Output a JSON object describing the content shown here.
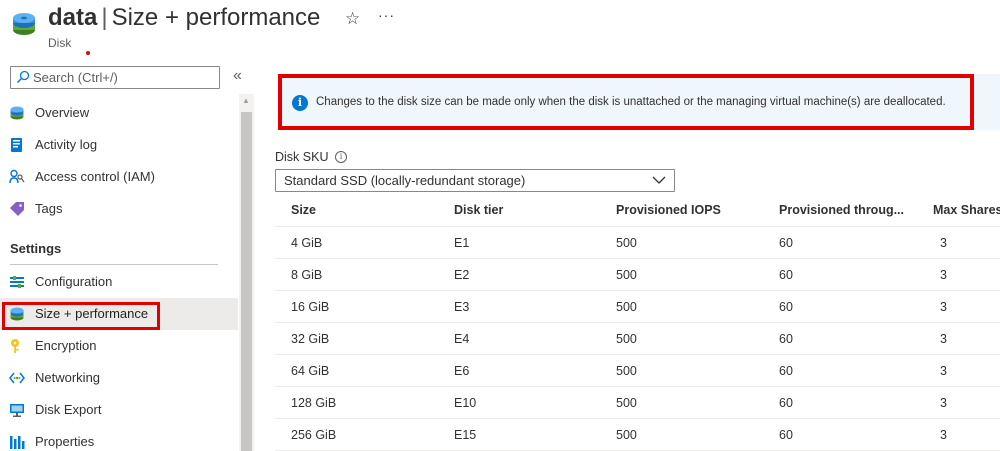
{
  "header": {
    "resource_name": "data",
    "separator": "|",
    "page_title": "Size + performance",
    "subtitle": "Disk",
    "favorite_icon": "star-icon",
    "more_icon": "more-icon"
  },
  "sidebar": {
    "search_placeholder": "Search (Ctrl+/)",
    "collapse_label": "«",
    "items_top": [
      {
        "label": "Overview",
        "icon": "disk-icon"
      },
      {
        "label": "Activity log",
        "icon": "activity-log-icon"
      },
      {
        "label": "Access control (IAM)",
        "icon": "access-control-icon"
      },
      {
        "label": "Tags",
        "icon": "tag-icon"
      }
    ],
    "section_title": "Settings",
    "items_settings": [
      {
        "label": "Configuration",
        "icon": "configuration-icon"
      },
      {
        "label": "Size + performance",
        "icon": "disk-icon",
        "active": true
      },
      {
        "label": "Encryption",
        "icon": "key-icon"
      },
      {
        "label": "Networking",
        "icon": "networking-icon"
      },
      {
        "label": "Disk Export",
        "icon": "export-icon"
      },
      {
        "label": "Properties",
        "icon": "properties-icon"
      }
    ]
  },
  "main": {
    "info_message": "Changes to the disk size can be made only when the disk is unattached or the managing virtual machine(s) are deallocated.",
    "sku_label": "Disk SKU",
    "sku_value": "Standard SSD (locally-redundant storage)",
    "table": {
      "columns": [
        "Size",
        "Disk tier",
        "Provisioned IOPS",
        "Provisioned throug...",
        "Max Shares"
      ],
      "rows": [
        [
          "4 GiB",
          "E1",
          "500",
          "60",
          "3"
        ],
        [
          "8 GiB",
          "E2",
          "500",
          "60",
          "3"
        ],
        [
          "16 GiB",
          "E3",
          "500",
          "60",
          "3"
        ],
        [
          "32 GiB",
          "E4",
          "500",
          "60",
          "3"
        ],
        [
          "64 GiB",
          "E6",
          "500",
          "60",
          "3"
        ],
        [
          "128 GiB",
          "E10",
          "500",
          "60",
          "3"
        ],
        [
          "256 GiB",
          "E15",
          "500",
          "60",
          "3"
        ]
      ]
    }
  },
  "colors": {
    "accent": "#0078d4",
    "highlight": "#e00000",
    "info_bg": "#eff6fc"
  }
}
